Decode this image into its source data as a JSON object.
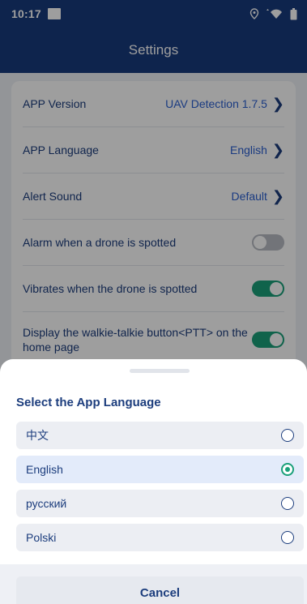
{
  "status_bar": {
    "time": "10:17",
    "icons": [
      "notification-box-icon",
      "location-pin-icon",
      "wifi-icon",
      "battery-icon"
    ]
  },
  "app_bar": {
    "title": "Settings"
  },
  "settings": [
    {
      "label": "APP Version",
      "value": "UAV Detection 1.7.5",
      "type": "link"
    },
    {
      "label": "APP Language",
      "value": "English",
      "type": "link"
    },
    {
      "label": "Alert Sound",
      "value": "Default",
      "type": "link"
    },
    {
      "label": "Alarm when a drone is spotted",
      "type": "toggle",
      "on": false
    },
    {
      "label": "Vibrates when the drone is spotted",
      "type": "toggle",
      "on": true
    },
    {
      "label": "Display the walkie-talkie button<PTT> on the home page",
      "type": "toggle",
      "on": true
    }
  ],
  "language_sheet": {
    "title": "Select the App Language",
    "options": [
      {
        "label": "中文",
        "selected": false
      },
      {
        "label": "English",
        "selected": true
      },
      {
        "label": "русский",
        "selected": false
      },
      {
        "label": "Polski",
        "selected": false
      }
    ],
    "cancel_label": "Cancel"
  },
  "colors": {
    "primary": "#183a7c",
    "accent_text": "#2b5fd0",
    "toggle_on": "#1aa07a",
    "toggle_off": "#b8bcc4"
  }
}
